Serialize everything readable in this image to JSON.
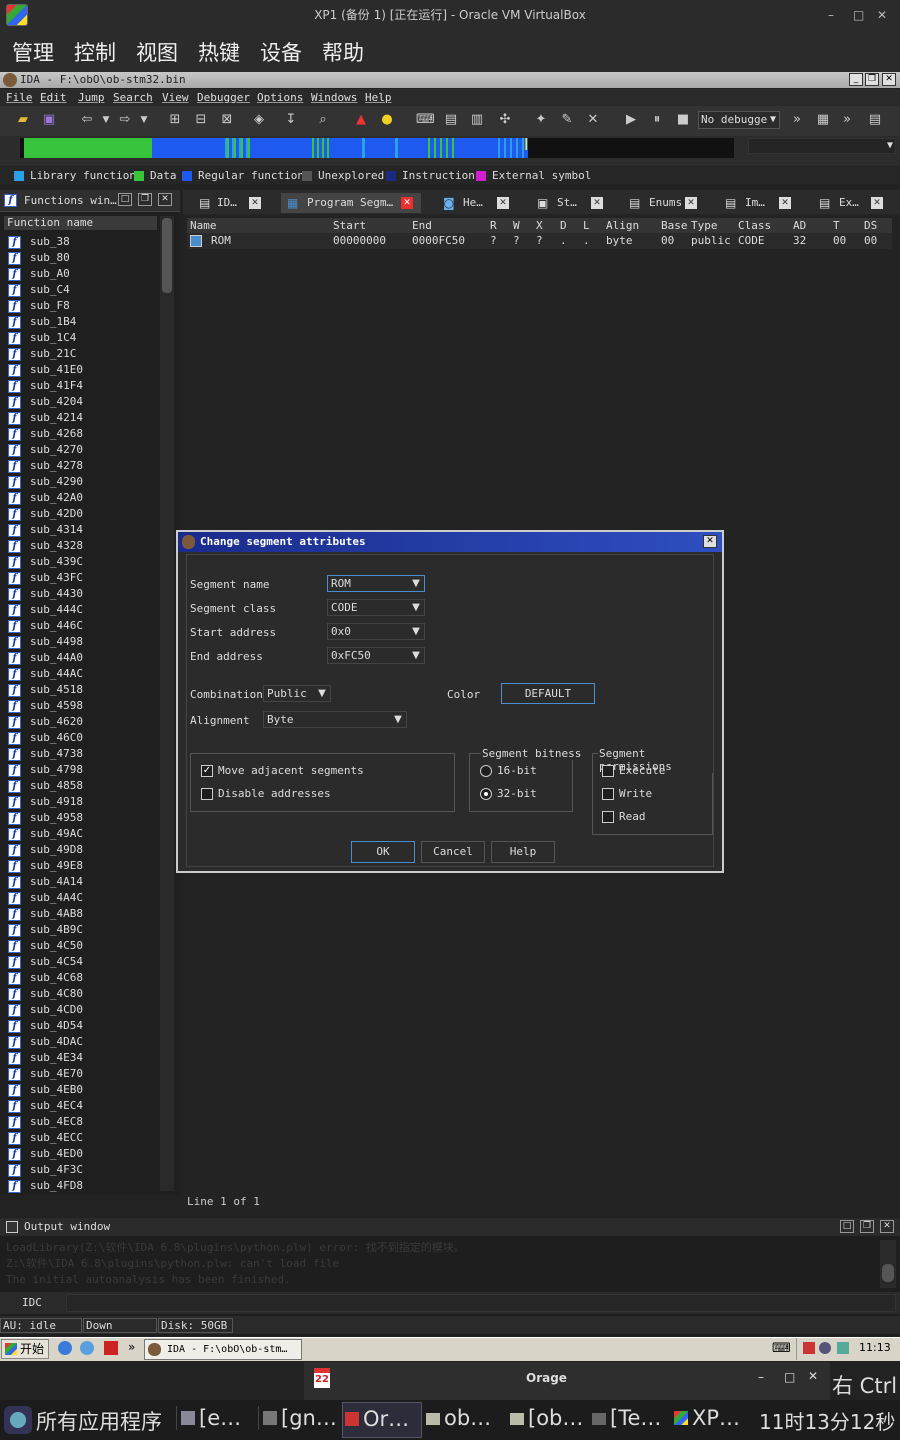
{
  "vbox": {
    "title": "XP1 (备份 1) [正在运行] - Oracle VM VirtualBox",
    "menu": [
      "管理",
      "控制",
      "视图",
      "热键",
      "设备",
      "帮助"
    ]
  },
  "ida": {
    "title": "IDA - F:\\obO\\ob-stm32.bin",
    "menu": [
      "File",
      "Edit",
      "Jump",
      "Search",
      "View",
      "Debugger",
      "Options",
      "Windows",
      "Help"
    ],
    "debugger_select": "No debugge",
    "legend": [
      {
        "label": "Library function",
        "color": "#2aa0e8"
      },
      {
        "label": "Data",
        "color": "#39c43d"
      },
      {
        "label": "Regular function",
        "color": "#1e5af0"
      },
      {
        "label": "Unexplored",
        "color": "#555555"
      },
      {
        "label": "Instruction",
        "color": "#1a2a80"
      },
      {
        "label": "External symbol",
        "color": "#d020d0"
      }
    ]
  },
  "functions": {
    "title": "Functions win…",
    "column": "Function name",
    "items": [
      "sub_38",
      "sub_80",
      "sub_A0",
      "sub_C4",
      "sub_F8",
      "sub_1B4",
      "sub_1C4",
      "sub_21C",
      "sub_41E0",
      "sub_41F4",
      "sub_4204",
      "sub_4214",
      "sub_4268",
      "sub_4270",
      "sub_4278",
      "sub_4290",
      "sub_42A0",
      "sub_42D0",
      "sub_4314",
      "sub_4328",
      "sub_439C",
      "sub_43FC",
      "sub_4430",
      "sub_444C",
      "sub_446C",
      "sub_4498",
      "sub_44A0",
      "sub_44AC",
      "sub_4518",
      "sub_4598",
      "sub_4620",
      "sub_46C0",
      "sub_4738",
      "sub_4798",
      "sub_4858",
      "sub_4918",
      "sub_4958",
      "sub_49AC",
      "sub_49D8",
      "sub_49E8",
      "sub_4A14",
      "sub_4A4C",
      "sub_4AB8",
      "sub_4B9C",
      "sub_4C50",
      "sub_4C54",
      "sub_4C68",
      "sub_4C80",
      "sub_4CD0",
      "sub_4D54",
      "sub_4DAC",
      "sub_4E34",
      "sub_4E70",
      "sub_4EB0",
      "sub_4EC4",
      "sub_4EC8",
      "sub_4ECC",
      "sub_4ED0",
      "sub_4F3C",
      "sub_4FD8"
    ]
  },
  "tabs": [
    "ID…",
    "Program Segm…",
    "He…",
    "St…",
    "Enums",
    "Im…",
    "Ex…"
  ],
  "segments": {
    "headers": [
      "Name",
      "Start",
      "End",
      "R",
      "W",
      "X",
      "D",
      "L",
      "Align",
      "Base",
      "Type",
      "Class",
      "AD",
      "T",
      "DS"
    ],
    "rows": [
      [
        "ROM",
        "00000000",
        "0000FC50",
        "?",
        "?",
        "?",
        ".",
        ".",
        "byte",
        "00",
        "public",
        "CODE",
        "32",
        "00",
        "00"
      ]
    ],
    "line_info": "Line 1 of 1"
  },
  "dialog": {
    "title": "Change segment attributes",
    "segment_name_label": "Segment name",
    "segment_name": "ROM",
    "segment_class_label": "Segment class",
    "segment_class": "CODE",
    "start_label": "Start address",
    "start": "0x0",
    "end_label": "End address",
    "end": "0xFC50",
    "combination_label": "Combination",
    "combination": "Public",
    "color_label": "Color",
    "color_btn": "DEFAULT",
    "alignment_label": "Alignment",
    "alignment": "Byte",
    "move_adjacent": "Move adjacent segments",
    "disable_addresses": "Disable addresses",
    "bitness_label": "Segment bitness",
    "bit16": "16-bit",
    "bit32": "32-bit",
    "perm_label": "Segment permissions",
    "execute": "Execute",
    "write": "Write",
    "read": "Read",
    "ok": "OK",
    "cancel": "Cancel",
    "help": "Help"
  },
  "output": {
    "title": "Output window",
    "lines": [
      "LoadLibrary(Z:\\软件\\IDA 6.8\\plugins\\python.plw) error: 找不到指定的模块。",
      "Z:\\软件\\IDA 6.8\\plugins\\python.plw: can't load file",
      "The initial autoanalysis has been finished."
    ],
    "idc": "IDC",
    "status_au": "AU:  idle",
    "status_down": "Down",
    "status_disk": "Disk: 50GB"
  },
  "xp_taskbar": {
    "start": "开始",
    "task": "IDA - F:\\obO\\ob-stm…",
    "clock": "11:13"
  },
  "orage": {
    "title": "Orage",
    "date_icon": "22"
  },
  "host": {
    "apps_menu": "所有应用程序",
    "items": [
      "[e…",
      "[gn…",
      "Or…",
      "ob…",
      "[ob…",
      "[Te…",
      "XP…"
    ],
    "clock": "11时13分12秒",
    "right_ctrl": "右 Ctrl"
  }
}
